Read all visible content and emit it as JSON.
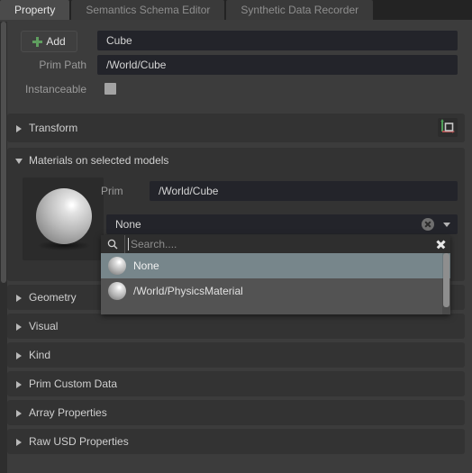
{
  "tabs": [
    {
      "label": "Property",
      "active": true
    },
    {
      "label": "Semantics Schema Editor",
      "active": false
    },
    {
      "label": "Synthetic Data Recorder",
      "active": false
    }
  ],
  "toolbar": {
    "add_label": "Add",
    "add_icon": "plus-icon"
  },
  "form": {
    "name_value": "Cube",
    "prim_path_label": "Prim Path",
    "prim_path_value": "/World/Cube",
    "instanceable_label": "Instanceable",
    "instanceable_checked": false
  },
  "sections": [
    {
      "title": "Transform",
      "expanded": false,
      "icon": "axis-gizmo-icon"
    },
    {
      "title": "Materials on selected models",
      "expanded": true
    },
    {
      "title": "Geometry",
      "expanded": false
    },
    {
      "title": "Visual",
      "expanded": false
    },
    {
      "title": "Kind",
      "expanded": false
    },
    {
      "title": "Prim Custom Data",
      "expanded": false
    },
    {
      "title": "Array Properties",
      "expanded": false
    },
    {
      "title": "Raw USD Properties",
      "expanded": false
    }
  ],
  "materials": {
    "prim_label": "Prim",
    "prim_value": "/World/Cube",
    "material_value": "None",
    "clear_icon": "circle-x-icon",
    "caret_icon": "chevron-down-icon",
    "preview_icon": "material-sphere-preview"
  },
  "dropdown": {
    "search_placeholder": "Search....",
    "search_icon": "search-icon",
    "clear_icon": "close-icon",
    "options": [
      {
        "label": "None",
        "selected": true
      },
      {
        "label": "/World/PhysicsMaterial",
        "selected": false
      }
    ]
  },
  "colors": {
    "panel_bg": "#3c3c3c",
    "section_bg": "#333333",
    "field_bg": "#23242a",
    "tab_active_bg": "#4b4b4b",
    "highlight": "#77868b",
    "popup_bg": "#535353",
    "accent_green": "#5f9e5f"
  }
}
